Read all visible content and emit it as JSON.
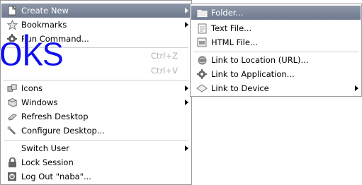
{
  "main_menu": {
    "items": [
      {
        "label": "Create New",
        "icon": "create-new-icon",
        "submenu": true,
        "highlight": true
      },
      {
        "label": "Bookmarks",
        "icon": "star-icon",
        "submenu": true
      },
      {
        "label": "Run Command...",
        "icon": "gear-icon"
      },
      {
        "label": "",
        "shortcut": "Ctrl+Z",
        "disabled": true
      },
      {
        "label": "",
        "shortcut": "Ctrl+V",
        "disabled": true
      },
      {
        "label": "Icons",
        "icon": "icons-icon",
        "submenu": true
      },
      {
        "label": "Windows",
        "icon": "windows-icon",
        "submenu": true
      },
      {
        "label": "Refresh Desktop",
        "icon": "refresh-icon"
      },
      {
        "label": "Configure Desktop...",
        "icon": "wrench-icon"
      },
      {
        "label": "Switch User",
        "submenu": true
      },
      {
        "label": "Lock Session",
        "icon": "lock-icon"
      },
      {
        "label": "Log Out \"naba\"...",
        "icon": "logout-icon"
      }
    ]
  },
  "sub_menu": {
    "items": [
      {
        "label": "Folder...",
        "icon": "folder-icon",
        "highlight": true
      },
      {
        "label": "Text File...",
        "icon": "text-file-icon"
      },
      {
        "label": "HTML File...",
        "icon": "html-file-icon"
      },
      {
        "label": "Link to Location (URL)...",
        "icon": "globe-icon"
      },
      {
        "label": "Link to Application...",
        "icon": "application-icon"
      },
      {
        "label": "Link to Device",
        "icon": "device-icon",
        "submenu": true
      }
    ]
  },
  "watermark": {
    "text": "oks"
  },
  "colors": {
    "highlight": "#7c8699",
    "watermark": "#1010ee",
    "border": "#9a9a9a"
  }
}
